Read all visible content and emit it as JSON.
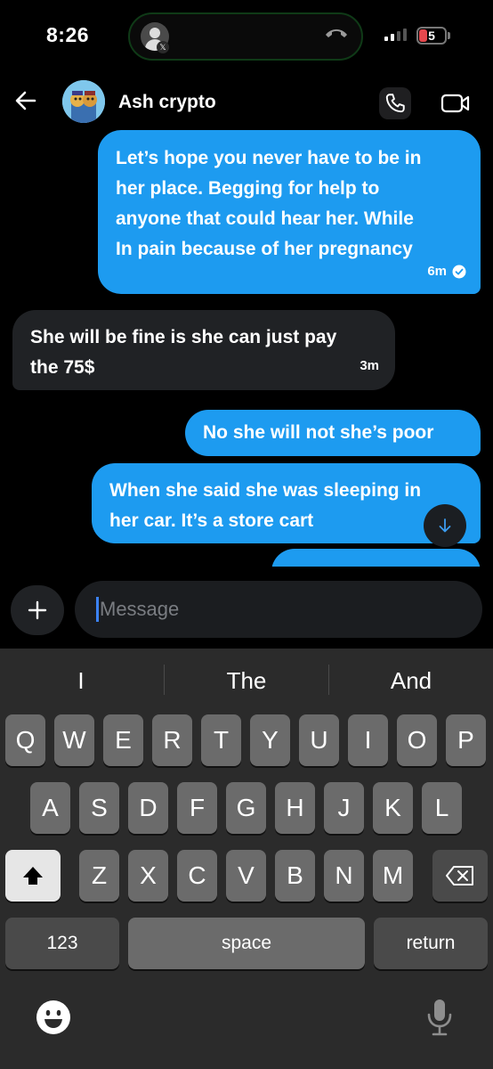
{
  "status_bar": {
    "time": "8:26",
    "battery": "5"
  },
  "header": {
    "contact_name": "Ash crypto"
  },
  "messages": [
    {
      "direction": "outgoing",
      "lines": [
        "Let’s hope you never have to be in",
        "her place. Begging for help to",
        "anyone that could hear her. While",
        "In pain because of her pregnancy"
      ],
      "time": "6m",
      "read": true
    },
    {
      "direction": "incoming",
      "lines": [
        "She will be fine is she can just pay",
        "the 75$"
      ],
      "time": "3m"
    },
    {
      "direction": "outgoing",
      "lines": [
        "No she will not she’s poor"
      ]
    },
    {
      "direction": "outgoing",
      "lines": [
        "When she said she was sleeping in",
        "her car. It’s a store cart"
      ]
    }
  ],
  "composer": {
    "placeholder": "Message"
  },
  "keyboard": {
    "suggestions": [
      "I",
      "The",
      "And"
    ],
    "row1": [
      "Q",
      "W",
      "E",
      "R",
      "T",
      "Y",
      "U",
      "I",
      "O",
      "P"
    ],
    "row2": [
      "A",
      "S",
      "D",
      "F",
      "G",
      "H",
      "J",
      "K",
      "L"
    ],
    "row3": [
      "Z",
      "X",
      "C",
      "V",
      "B",
      "N",
      "M"
    ],
    "numbers_label": "123",
    "space_label": "space",
    "return_label": "return"
  },
  "colors": {
    "outgoing_bubble": "#1d9bf0",
    "incoming_bubble": "#202225",
    "background": "#000000"
  },
  "icons": [
    "back-arrow-icon",
    "phone-icon",
    "video-icon",
    "check-icon",
    "arrow-down-icon",
    "plus-icon",
    "shift-icon",
    "backspace-icon",
    "emoji-icon",
    "microphone-icon"
  ]
}
